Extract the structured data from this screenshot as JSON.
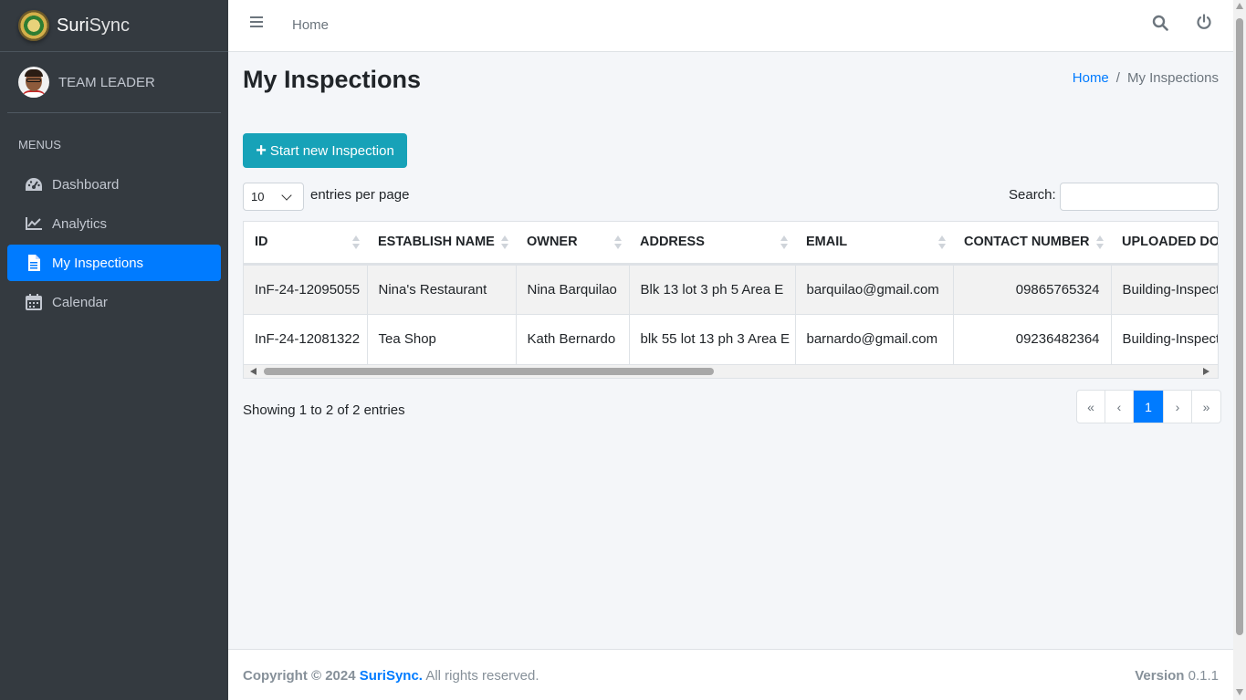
{
  "brand": {
    "name_bold": "Suri",
    "name_light": "Sync"
  },
  "user": {
    "role": "TEAM LEADER"
  },
  "sidebar": {
    "header": "MENUS",
    "items": [
      {
        "label": "Dashboard",
        "icon": "gauge-icon"
      },
      {
        "label": "Analytics",
        "icon": "chart-line-icon"
      },
      {
        "label": "My Inspections",
        "icon": "file-icon",
        "active": true
      },
      {
        "label": "Calendar",
        "icon": "calendar-icon"
      }
    ]
  },
  "topbar": {
    "home": "Home"
  },
  "page": {
    "title": "My Inspections",
    "breadcrumb": {
      "home": "Home",
      "sep": "/",
      "current": "My Inspections"
    },
    "start_button": "Start new Inspection",
    "length_value": "10",
    "length_label": "entries per page",
    "search_label": "Search:"
  },
  "table": {
    "headers": [
      "ID",
      "ESTABLISH NAME",
      "OWNER",
      "ADDRESS",
      "EMAIL",
      "CONTACT NUMBER",
      "UPLOADED DOC"
    ],
    "rows": [
      [
        "InF-24-12095055",
        "Nina's Restaurant",
        "Nina Barquilao",
        "Blk 13 lot 3 ph 5 Area E",
        "barquilao@gmail.com",
        "09865765324",
        "Building-Inspection"
      ],
      [
        "InF-24-12081322",
        "Tea Shop",
        "Kath Bernardo",
        "blk 55 lot 13 ph 3 Area E",
        "barnardo@gmail.com",
        "09236482364",
        "Building-Inspection"
      ]
    ]
  },
  "pagination": {
    "info": "Showing 1 to 2 of 2 entries",
    "first": "«",
    "prev": "‹",
    "current": "1",
    "next": "›",
    "last": "»"
  },
  "footer": {
    "copyright": "Copyright © 2024",
    "brand": "SuriSync.",
    "rights": "All rights reserved.",
    "version_label": "Version",
    "version": "0.1.1"
  },
  "colors": {
    "sidebar": "#343a40",
    "active": "#007bff",
    "button": "#17a2b8"
  }
}
